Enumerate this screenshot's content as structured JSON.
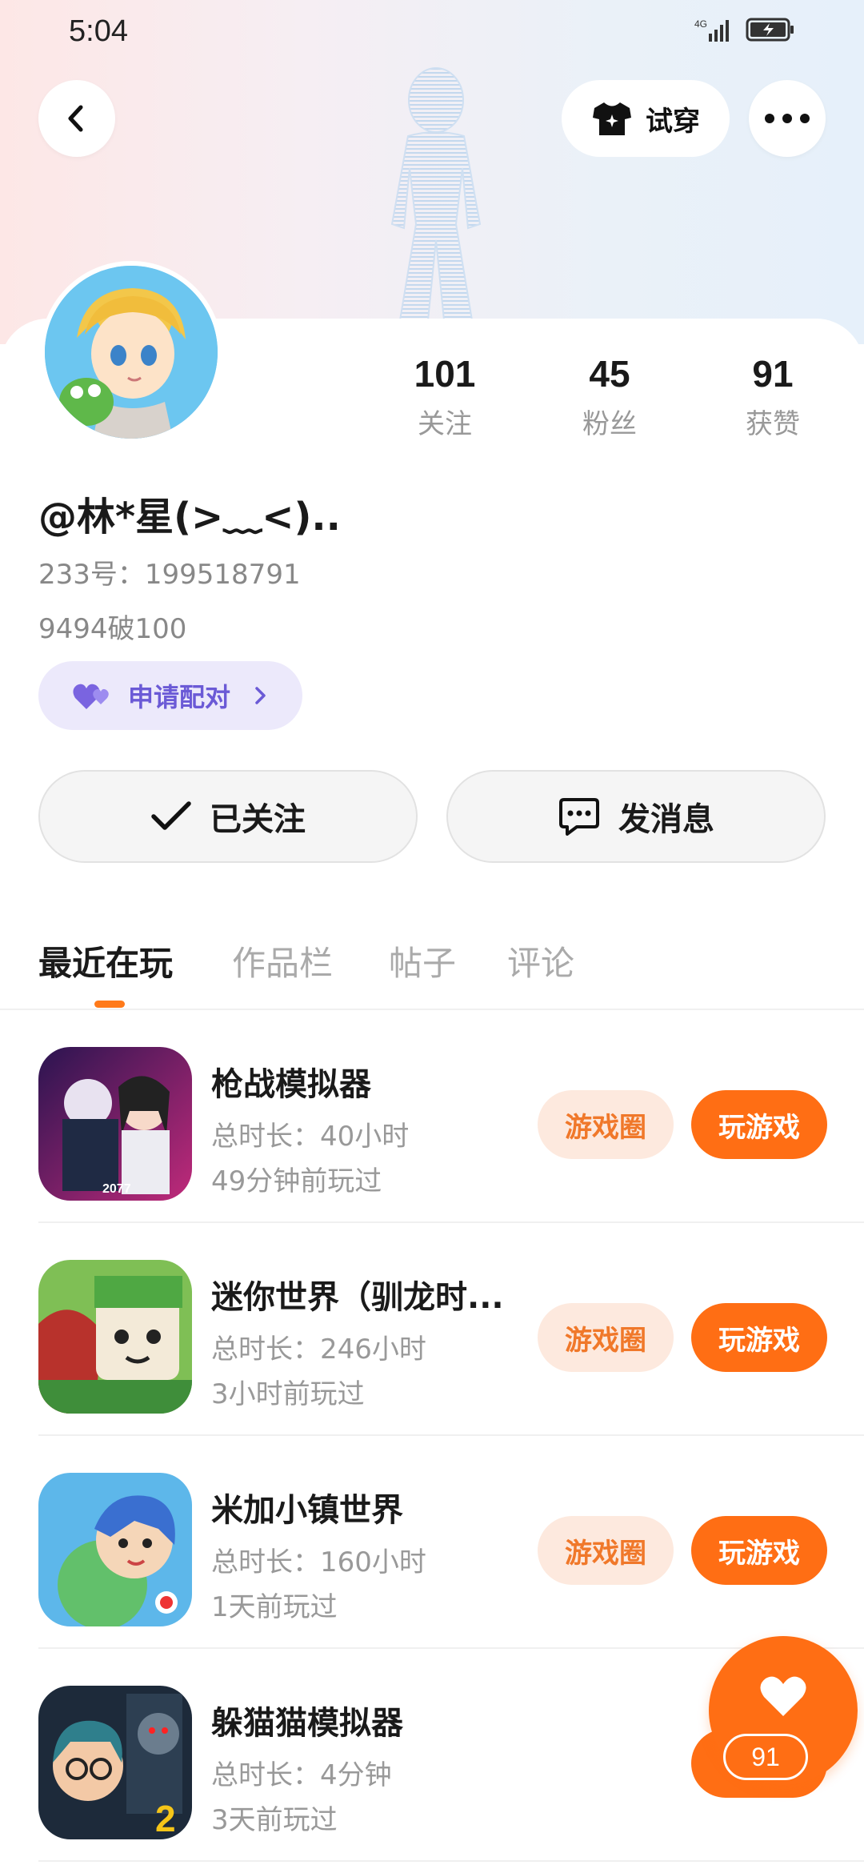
{
  "status_bar": {
    "time": "5:04",
    "network": "4G"
  },
  "header": {
    "tryon_label": "试穿"
  },
  "profile": {
    "stats": [
      {
        "value": "101",
        "label": "关注"
      },
      {
        "value": "45",
        "label": "粉丝"
      },
      {
        "value": "91",
        "label": "获赞"
      }
    ],
    "username": "@林*星(>﹏<)..",
    "user_id": "233号：199518791",
    "bio": "9494破100",
    "pair_label": "申请配对"
  },
  "actions": {
    "follow_label": "已关注",
    "message_label": "发消息"
  },
  "tabs": [
    {
      "label": "最近在玩",
      "active": true
    },
    {
      "label": "作品栏",
      "active": false
    },
    {
      "label": "帖子",
      "active": false
    },
    {
      "label": "评论",
      "active": false
    }
  ],
  "games": [
    {
      "title": "枪战模拟器",
      "duration": "总时长：40小时",
      "last_played": "49分钟前玩过",
      "circle_label": "游戏圈",
      "play_label": "玩游戏"
    },
    {
      "title": "迷你世界（驯龙时...",
      "duration": "总时长：246小时",
      "last_played": "3小时前玩过",
      "circle_label": "游戏圈",
      "play_label": "玩游戏"
    },
    {
      "title": "米加小镇世界",
      "duration": "总时长：160小时",
      "last_played": "1天前玩过",
      "circle_label": "游戏圈",
      "play_label": "玩游戏"
    },
    {
      "title": "躲猫猫模拟器",
      "duration": "总时长：4分钟",
      "last_played": "3天前玩过",
      "circle_label": "",
      "play_label": ""
    }
  ],
  "like_fab": {
    "count": "91"
  },
  "colors": {
    "accent": "#ff6e14",
    "accent_soft": "#fde9de",
    "pair": "#6b5ad6"
  }
}
